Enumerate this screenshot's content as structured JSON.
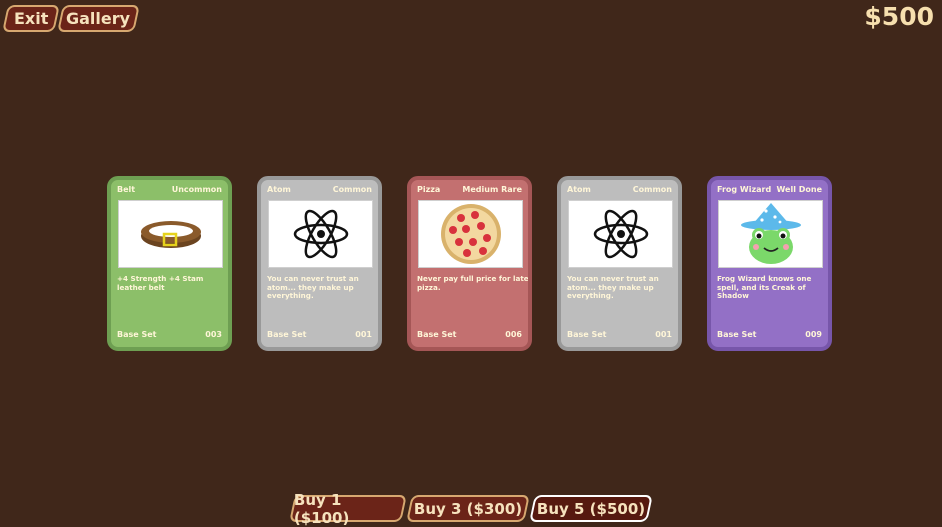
{
  "header": {
    "exit_label": "Exit",
    "gallery_label": "Gallery",
    "money": "$500"
  },
  "cards": [
    {
      "name": "Belt",
      "rarity": "Uncommon",
      "description": "+4 Strength +4 Stam leather belt",
      "set": "Base Set",
      "number": "003",
      "color": "#8cbf69",
      "art_icon": "belt-icon"
    },
    {
      "name": "Atom",
      "rarity": "Common",
      "description": "You can never trust an atom... they make up everything.",
      "set": "Base Set",
      "number": "001",
      "color": "#bdbdbd",
      "art_icon": "atom-icon"
    },
    {
      "name": "Pizza",
      "rarity": "Medium Rare",
      "description": "Never pay full price for late pizza.",
      "set": "Base Set",
      "number": "006",
      "color": "#c37070",
      "art_icon": "pizza-icon"
    },
    {
      "name": "Atom",
      "rarity": "Common",
      "description": "You can never trust an atom... they make up everything.",
      "set": "Base Set",
      "number": "001",
      "color": "#bdbdbd",
      "art_icon": "atom-icon"
    },
    {
      "name": "Frog Wizard",
      "rarity": "Well Done",
      "description": "Frog Wizard knows one spell, and its Creak of Shadow",
      "set": "Base Set",
      "number": "009",
      "color": "#9370c6",
      "art_icon": "frog-wizard-icon"
    }
  ],
  "buy": {
    "buy1_label": "Buy 1 ($100)",
    "buy3_label": "Buy 3 ($300)",
    "buy5_label": "Buy 5 ($500)",
    "selected": "Buy 5 ($500)"
  }
}
